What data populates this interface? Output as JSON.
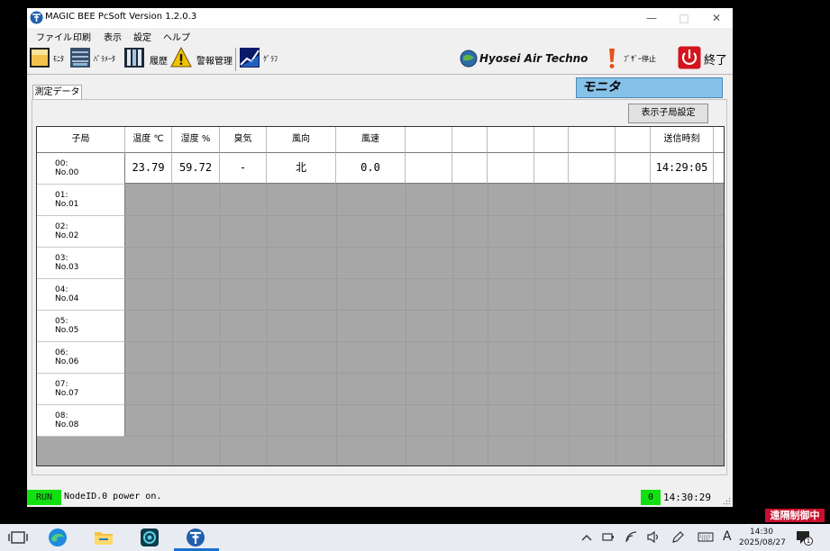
{
  "window": {
    "title": "MAGIC BEE PcSoft Version 1.2.0.3",
    "minimize": "—",
    "maximize": "□",
    "close": "✕"
  },
  "menu": [
    "ファイル",
    "印刷",
    "表示",
    "設定",
    "ヘルプ"
  ],
  "toolbar": {
    "monitor": "ﾓﾆﾀ",
    "parameter": "ﾊﾟﾗﾒｰﾀ",
    "history": "履歴",
    "alarm": "警報管理",
    "graph": "ｸﾞﾗﾌ",
    "logo": "Hyosei Air Techno",
    "buzzer_stop": "ﾌﾞｻﾞｰ停止",
    "exit": "終了"
  },
  "tab_label": "測定データ",
  "mode_label": "モニタ",
  "display_button": "表示子局設定",
  "table": {
    "headers": [
      "子局",
      "温度 ℃",
      "湿度 %",
      "臭気",
      "風向",
      "風速",
      "",
      "",
      "",
      "",
      "",
      "",
      "送信時刻"
    ],
    "row0": [
      "23.79",
      "59.72",
      "-",
      "北",
      "0.0",
      "",
      "",
      "",
      "",
      "",
      "",
      "14:29:05"
    ],
    "stations": [
      {
        "id": "00:",
        "name": "No.00"
      },
      {
        "id": "01:",
        "name": "No.01"
      },
      {
        "id": "02:",
        "name": "No.02"
      },
      {
        "id": "03:",
        "name": "No.03"
      },
      {
        "id": "04:",
        "name": "No.04"
      },
      {
        "id": "05:",
        "name": "No.05"
      },
      {
        "id": "06:",
        "name": "No.06"
      },
      {
        "id": "07:",
        "name": "No.07"
      },
      {
        "id": "08:",
        "name": "No.08"
      }
    ]
  },
  "status": {
    "run": "RUN",
    "message": "NodeID.0 power on.",
    "count": "0",
    "time": "14:30:29"
  },
  "remote_badge": "遠隔制御中",
  "taskbar": {
    "time": "14:30",
    "date": "2025/08/27",
    "ime": "A",
    "notification_count": "1"
  },
  "colors": {
    "status_green": "#12e012",
    "mode_blue": "#86c1e8",
    "grid_empty": "#a7a7a7",
    "remote_red": "#c8102e"
  }
}
